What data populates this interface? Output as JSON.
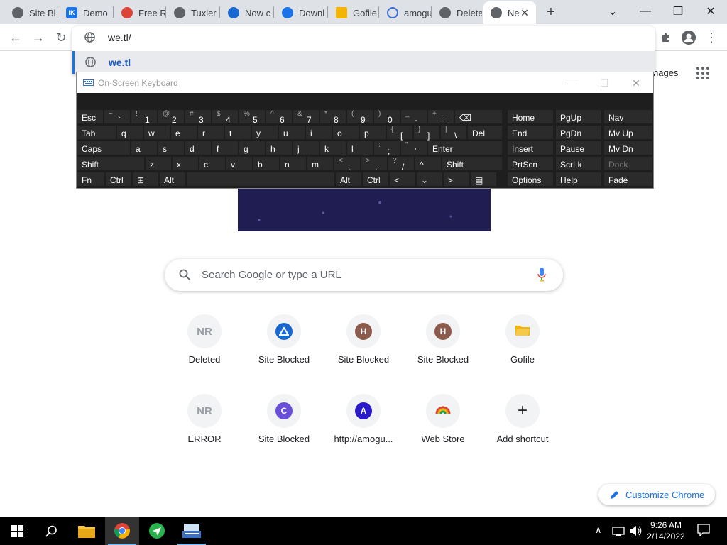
{
  "tabs": [
    {
      "label": "Site Bl",
      "icon": "chrome-icon",
      "color": "#5f6368"
    },
    {
      "label": "Demo",
      "icon": "ik-icon",
      "color": "#1a73e8"
    },
    {
      "label": "Free R",
      "icon": "rainbow-icon",
      "color": "#db4437"
    },
    {
      "label": "Tuxler",
      "icon": "chrome-icon",
      "color": "#5f6368"
    },
    {
      "label": "Now c",
      "icon": "triangle-icon",
      "color": "#1967d2"
    },
    {
      "label": "Downl",
      "icon": "download-icon",
      "color": "#1a73e8"
    },
    {
      "label": "Gofile",
      "icon": "folder-icon",
      "color": "#f4b400"
    },
    {
      "label": "amogu",
      "icon": "spinner-icon",
      "color": "#3c6fd8"
    },
    {
      "label": "Delete",
      "icon": "chrome-icon",
      "color": "#5f6368"
    },
    {
      "label": "Ne",
      "icon": "chrome-icon",
      "color": "#5f6368"
    }
  ],
  "omnibox": {
    "value": "we.tl/",
    "suggestion": "we.tl"
  },
  "ntp": {
    "images_link": "nages",
    "search_placeholder": "Search Google or type a URL",
    "customize_label": "Customize Chrome"
  },
  "shortcuts": [
    {
      "label": "Deleted",
      "glyph": "NR",
      "style": "text",
      "color": "#9aa0a6"
    },
    {
      "label": "Site Blocked",
      "glyph": "",
      "style": "triangle",
      "color": "#1967d2"
    },
    {
      "label": "Site Blocked",
      "glyph": "H",
      "style": "circle",
      "color": "#8d5a4e"
    },
    {
      "label": "Site Blocked",
      "glyph": "H",
      "style": "circle",
      "color": "#8d5a4e"
    },
    {
      "label": "Gofile",
      "glyph": "",
      "style": "folder",
      "color": "#f4b400"
    },
    {
      "label": "ERROR",
      "glyph": "NR",
      "style": "text",
      "color": "#9aa0a6"
    },
    {
      "label": "Site Blocked",
      "glyph": "C",
      "style": "circle",
      "color": "#6a4fd8"
    },
    {
      "label": "http://amogu...",
      "glyph": "A",
      "style": "circle",
      "color": "#2a1bc9"
    },
    {
      "label": "Web Store",
      "glyph": "",
      "style": "rainbow",
      "color": "#db4437"
    },
    {
      "label": "Add shortcut",
      "glyph": "+",
      "style": "plus",
      "color": "#202124"
    }
  ],
  "osk": {
    "title": "On-Screen Keyboard",
    "rows": [
      [
        {
          "main": "Esc"
        },
        {
          "sec": "~",
          "pri": "`"
        },
        {
          "sec": "!",
          "pri": "1"
        },
        {
          "sec": "@",
          "pri": "2"
        },
        {
          "sec": "#",
          "pri": "3"
        },
        {
          "sec": "$",
          "pri": "4"
        },
        {
          "sec": "%",
          "pri": "5"
        },
        {
          "sec": "^",
          "pri": "6"
        },
        {
          "sec": "&",
          "pri": "7"
        },
        {
          "sec": "*",
          "pri": "8"
        },
        {
          "sec": "(",
          "pri": "9"
        },
        {
          "sec": ")",
          "pri": "0"
        },
        {
          "sec": "_",
          "pri": "-"
        },
        {
          "sec": "+",
          "pri": "="
        },
        {
          "main": "⌫"
        }
      ],
      [
        {
          "main": "Tab"
        },
        {
          "main": "q"
        },
        {
          "main": "w"
        },
        {
          "main": "e"
        },
        {
          "main": "r"
        },
        {
          "main": "t"
        },
        {
          "main": "y"
        },
        {
          "main": "u"
        },
        {
          "main": "i"
        },
        {
          "main": "o"
        },
        {
          "main": "p"
        },
        {
          "sec": "{",
          "pri": "["
        },
        {
          "sec": "}",
          "pri": "]"
        },
        {
          "sec": "|",
          "pri": "\\"
        },
        {
          "main": "Del"
        }
      ],
      [
        {
          "main": "Caps"
        },
        {
          "main": "a"
        },
        {
          "main": "s"
        },
        {
          "main": "d"
        },
        {
          "main": "f"
        },
        {
          "main": "g"
        },
        {
          "main": "h"
        },
        {
          "main": "j"
        },
        {
          "main": "k"
        },
        {
          "main": "l"
        },
        {
          "sec": ":",
          "pri": ";"
        },
        {
          "sec": "\"",
          "pri": "'"
        },
        {
          "main": "Enter"
        }
      ],
      [
        {
          "main": "Shift"
        },
        {
          "main": "z"
        },
        {
          "main": "x"
        },
        {
          "main": "c"
        },
        {
          "main": "v"
        },
        {
          "main": "b"
        },
        {
          "main": "n"
        },
        {
          "main": "m"
        },
        {
          "sec": "<",
          "pri": ","
        },
        {
          "sec": ">",
          "pri": "."
        },
        {
          "sec": "?",
          "pri": "/"
        },
        {
          "main": "^"
        },
        {
          "main": "Shift"
        }
      ],
      [
        {
          "main": "Fn"
        },
        {
          "main": "Ctrl"
        },
        {
          "main": "⊞"
        },
        {
          "main": "Alt"
        },
        {
          "main": ""
        },
        {
          "main": "Alt"
        },
        {
          "main": "Ctrl"
        },
        {
          "main": "<"
        },
        {
          "main": "⌄"
        },
        {
          "main": ">"
        },
        {
          "main": "▤"
        }
      ]
    ],
    "side_keys": [
      [
        "Home",
        "PgUp",
        "Nav"
      ],
      [
        "End",
        "PgDn",
        "Mv Up"
      ],
      [
        "Insert",
        "Pause",
        "Mv Dn"
      ],
      [
        "PrtScn",
        "ScrLk",
        "Dock"
      ],
      [
        "Options",
        "Help",
        "Fade"
      ]
    ]
  },
  "taskbar": {
    "time": "9:26 AM",
    "date": "2/14/2022"
  }
}
